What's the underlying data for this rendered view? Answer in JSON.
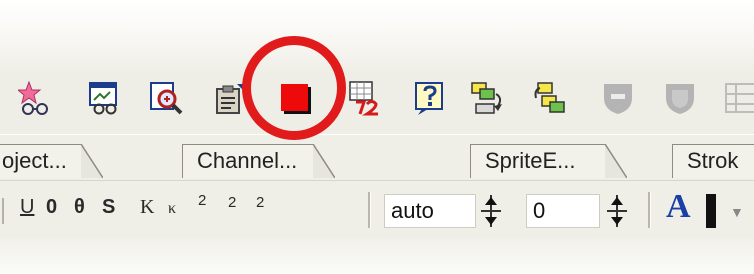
{
  "toolbar": {
    "icons": [
      "cast-members-icon",
      "preview-window-icon",
      "find-zoom-icon",
      "paste-clipboard-icon",
      "red-stop-square-icon",
      "frame-number-icon",
      "help-question-icon",
      "copy-sprites-icon",
      "paste-sprites-icon",
      "shield-gray-icon",
      "shield-gray-2-icon",
      "grid-icon"
    ],
    "highlight_color": "#e11b1b"
  },
  "tabs": [
    {
      "label": "oject..."
    },
    {
      "label": "Channel..."
    },
    {
      "label": "SpriteE..."
    },
    {
      "label": "Strok"
    }
  ],
  "format_bar": {
    "underline_label": "U",
    "style_glyphs": [
      "0",
      "θ",
      "S",
      "K",
      "κ",
      "2",
      "2",
      "2"
    ],
    "size_value": "auto",
    "spacing_value": "0",
    "font_button_label": "A"
  }
}
